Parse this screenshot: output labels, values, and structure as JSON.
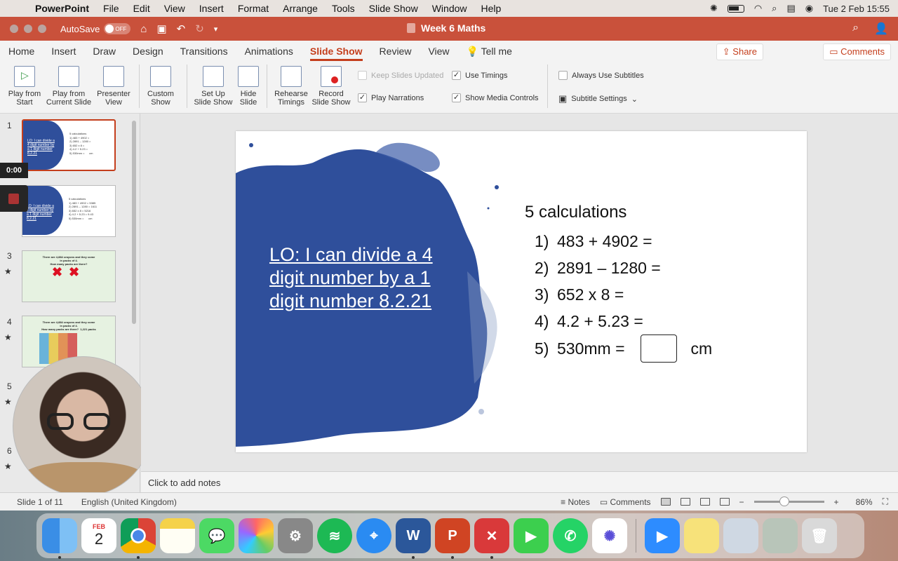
{
  "menubar": {
    "app": "PowerPoint",
    "items": [
      "File",
      "Edit",
      "View",
      "Insert",
      "Format",
      "Arrange",
      "Tools",
      "Slide Show",
      "Window",
      "Help"
    ],
    "clock": "Tue 2 Feb  15:55"
  },
  "titlebar": {
    "autosave_label": "AutoSave",
    "autosave_state": "OFF",
    "doc_title": "Week 6 Maths"
  },
  "tabs": {
    "items": [
      "Home",
      "Insert",
      "Draw",
      "Design",
      "Transitions",
      "Animations",
      "Slide Show",
      "Review",
      "View"
    ],
    "active": "Slide Show",
    "tell_me": "Tell me",
    "share": "Share",
    "comments": "Comments"
  },
  "ribbon": {
    "play_start": [
      "Play from",
      "Start"
    ],
    "play_current": [
      "Play from",
      "Current Slide"
    ],
    "presenter": [
      "Presenter",
      "View"
    ],
    "custom": [
      "Custom",
      "Show"
    ],
    "setup": [
      "Set Up",
      "Slide Show"
    ],
    "hide": [
      "Hide",
      "Slide"
    ],
    "rehearse": [
      "Rehearse",
      "Timings"
    ],
    "record": [
      "Record",
      "Slide Show"
    ],
    "keep_updated": "Keep Slides Updated",
    "use_timings": "Use Timings",
    "play_narrations": "Play Narrations",
    "show_media": "Show Media Controls",
    "always_subtitles": "Always Use Subtitles",
    "subtitle_settings": "Subtitle Settings"
  },
  "thumbs": {
    "numbers": [
      "1",
      "3",
      "4",
      "5",
      "6"
    ],
    "star": "★",
    "timer": "0:00",
    "slide1_title": "LO: I can divide a 4 digit number by a 1 digit number 8.2.21",
    "slide1_calc": "5 calculations\n1) 483 + 4902 =\n2) 2891 – 1280 =\n3) 652 x 8 =\n4) 4.2 + 5.23 =\n5) 530mm =      cm",
    "slide2_calc": "5 calculations\n1) 483 + 4902 = 5385\n2) 2891 – 1280 = 1611\n3) 652 x 8 = 5216\n4) 4.2 + 5.23 = 9.43\n5) 530mm =      cm",
    "slide3_text": "There are 4,884 crayons and they come\nin packs of 4.\nHow many packs are there?",
    "slide4_text": "There are 4,884 crayons and they come\nin packs of 4.\nHow many packs are there?  1,221 packs"
  },
  "slide": {
    "title": "LO: I can divide a 4 digit number by a 1 digit number 8.2.21",
    "calc_title": "5 calculations",
    "calcs": [
      {
        "n": "1)",
        "text": "483 + 4902 ="
      },
      {
        "n": "2)",
        "text": "2891 – 1280 ="
      },
      {
        "n": "3)",
        "text": "652 x 8 ="
      },
      {
        "n": "4)",
        "text": "4.2 + 5.23 ="
      },
      {
        "n": "5)",
        "text": "530mm =",
        "unit": "cm"
      }
    ],
    "blob_color": "#2f4f9b"
  },
  "notes": {
    "placeholder": "Click to add notes"
  },
  "statusbar": {
    "slide_info": "Slide 1 of 11",
    "language": "English (United Kingdom)",
    "notes": "Notes",
    "comments": "Comments",
    "zoom": "86%"
  },
  "dock": {
    "calendar_month": "FEB",
    "calendar_day": "2"
  },
  "colors": {
    "accent": "#c43e1c",
    "titlebar": "#c9513b"
  }
}
